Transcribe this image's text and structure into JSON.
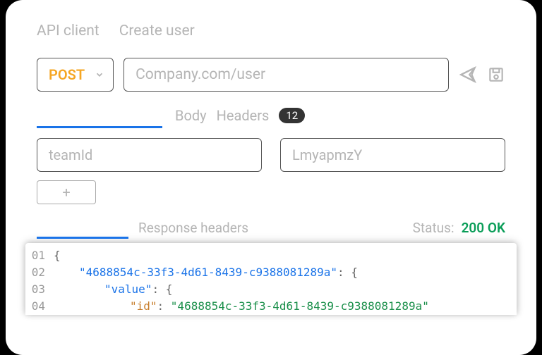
{
  "breadcrumbs": {
    "item1": "API client",
    "item2": "Create user"
  },
  "request": {
    "method": "POST",
    "url": "Company.com/user"
  },
  "tabs": {
    "body": "Body",
    "headers": "Headers",
    "header_count": "12"
  },
  "kv": {
    "key": "teamId",
    "value": "LmyapmzY",
    "add": "+"
  },
  "response": {
    "headers_label": "Response headers",
    "status_label": "Status:",
    "status_value": "200 OK",
    "code": {
      "l1_no": "01",
      "l2_no": "02",
      "l3_no": "03",
      "l4_no": "04",
      "key_root": "\"4688854c-33f3-4d61-8439-c9388081289a\"",
      "key_value": "\"value\"",
      "key_id": "\"id\"",
      "val_id": "\"4688854c-33f3-4d61-8439-c9388081289a\"",
      "brace_open": "{",
      "colon_brace": ": {",
      "colon": ": "
    }
  }
}
